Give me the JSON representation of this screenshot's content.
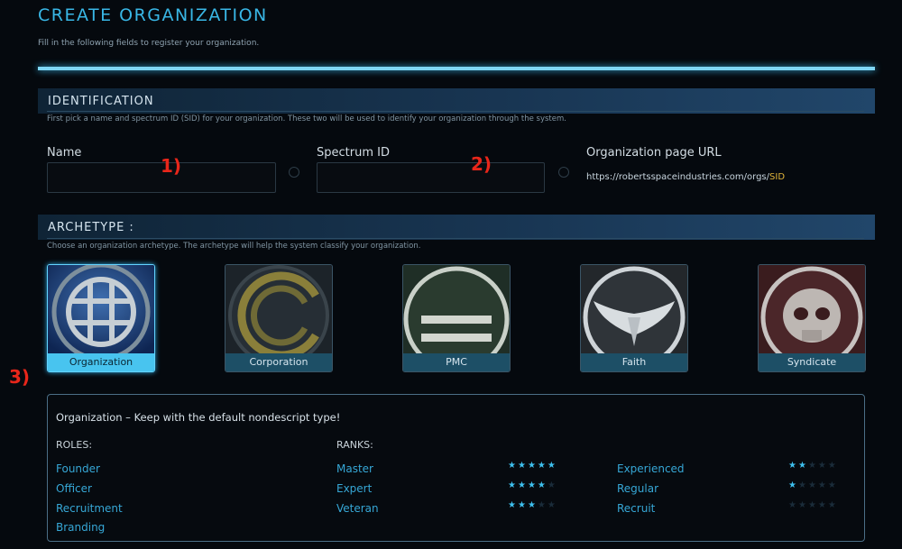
{
  "header": {
    "title": "CREATE ORGANIZATION",
    "subtitle": "Fill in the following fields to register your organization."
  },
  "identification": {
    "heading": "IDENTIFICATION",
    "description": "First pick a name and spectrum ID (SID) for your organization. These two will be used to identify your organization through the system.",
    "name_label": "Name",
    "name_value": "",
    "sid_label": "Spectrum ID",
    "sid_value": "",
    "url_label": "Organization page URL",
    "url_prefix": "https://robertsspaceindustries.com/orgs/",
    "url_suffix": "SID"
  },
  "annotations": {
    "a1": "1)",
    "a2": "2)",
    "a3": "3)"
  },
  "archetype": {
    "heading": "ARCHETYPE :",
    "description": "Choose an organization archetype. The archetype will help the system classify your organization.",
    "tiles": [
      {
        "label": "Organization",
        "selected": true,
        "icon": "globe-emblem-icon"
      },
      {
        "label": "Corporation",
        "selected": false,
        "icon": "crescent-emblem-icon"
      },
      {
        "label": "PMC",
        "selected": false,
        "icon": "bars-emblem-icon"
      },
      {
        "label": "Faith",
        "selected": false,
        "icon": "wings-emblem-icon"
      },
      {
        "label": "Syndicate",
        "selected": false,
        "icon": "skull-emblem-icon"
      }
    ]
  },
  "info": {
    "title": "Organization – Keep with the default nondescript type!",
    "roles_heading": "ROLES:",
    "ranks_heading": "RANKS:",
    "roles": [
      "Founder",
      "Officer",
      "Recruitment",
      "Branding"
    ],
    "ranks": [
      {
        "name": "Master",
        "stars": 5
      },
      {
        "name": "Expert",
        "stars": 4
      },
      {
        "name": "Veteran",
        "stars": 3
      },
      {
        "name": "Experienced",
        "stars": 2
      },
      {
        "name": "Regular",
        "stars": 1
      },
      {
        "name": "Recruit",
        "stars": 0
      }
    ],
    "max_stars": 5
  },
  "colors": {
    "accent": "#39b7e6",
    "highlight_bar": "#7fd6f5",
    "star_on": "#3ec0ee",
    "annotation": "#e8261a",
    "sid_highlight": "#e1b53a"
  }
}
